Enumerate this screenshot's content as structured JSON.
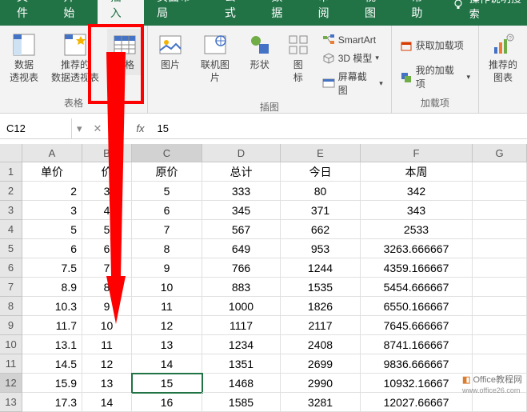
{
  "tabs": {
    "file": "文件",
    "home": "开始",
    "insert": "插入",
    "pagelayout": "页面布局",
    "formulas": "公式",
    "data": "数据",
    "review": "审阅",
    "view": "视图",
    "help": "帮助"
  },
  "tellme": "操作说明搜索",
  "ribbon": {
    "tables": {
      "pivot": "数据\n透视表",
      "recommended": "推荐的\n数据透视表",
      "table": "表格",
      "group": "表格"
    },
    "illustrations": {
      "pictures": "图片",
      "online_pictures": "联机图片",
      "shapes": "形状",
      "icons": "图\n标",
      "smartart": "SmartArt",
      "model3d": "3D 模型",
      "screenshot": "屏幕截图",
      "group": "插图"
    },
    "addins": {
      "get": "获取加载项",
      "my": "我的加载项",
      "group": "加载项"
    },
    "charts": {
      "recommended": "推荐的\n图表"
    }
  },
  "formula_bar": {
    "name_box": "C12",
    "value": "15"
  },
  "columns": [
    "A",
    "B",
    "C",
    "D",
    "E",
    "F",
    "G"
  ],
  "chart_data": {
    "type": "table",
    "headers": [
      "单价",
      "价",
      "原价",
      "总计",
      "今日",
      "本周"
    ],
    "rows": [
      [
        "2",
        "3",
        "5",
        "333",
        "80",
        "342"
      ],
      [
        "3",
        "4",
        "6",
        "345",
        "371",
        "343"
      ],
      [
        "5",
        "5",
        "7",
        "567",
        "662",
        "2533"
      ],
      [
        "6",
        "6",
        "8",
        "649",
        "953",
        "3263.666667"
      ],
      [
        "7.5",
        "7",
        "9",
        "766",
        "1244",
        "4359.166667"
      ],
      [
        "8.9",
        "8",
        "10",
        "883",
        "1535",
        "5454.666667"
      ],
      [
        "10.3",
        "9",
        "11",
        "1000",
        "1826",
        "6550.166667"
      ],
      [
        "11.7",
        "10",
        "12",
        "1117",
        "2117",
        "7645.666667"
      ],
      [
        "13.1",
        "11",
        "13",
        "1234",
        "2408",
        "8741.166667"
      ],
      [
        "14.5",
        "12",
        "14",
        "1351",
        "2699",
        "9836.666667"
      ],
      [
        "15.9",
        "13",
        "15",
        "1468",
        "2990",
        "10932.16667"
      ],
      [
        "17.3",
        "14",
        "16",
        "1585",
        "3281",
        "12027.66667"
      ]
    ]
  },
  "selected_cell": {
    "row": 12,
    "col": "C"
  },
  "watermark": {
    "brand": "Office教程网",
    "url": "www.office26.com"
  }
}
